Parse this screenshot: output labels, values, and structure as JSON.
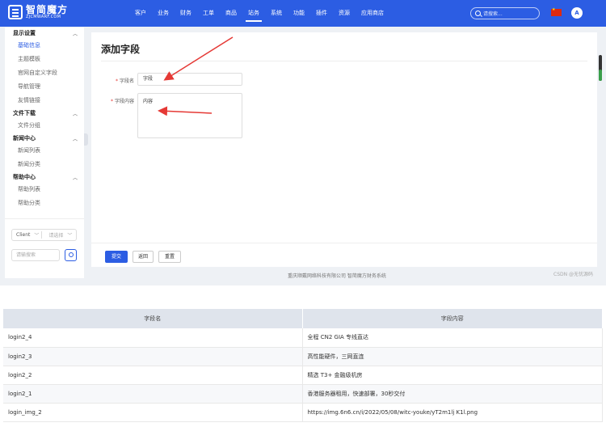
{
  "logo": {
    "cn": "智简魔方",
    "en": "ZJCMWARF.COM"
  },
  "nav": {
    "items": [
      "客户",
      "业务",
      "财务",
      "工单",
      "商品",
      "站务",
      "系统",
      "功能",
      "插件",
      "资源",
      "应用商店"
    ],
    "active_index": 5,
    "search_placeholder": "请搜索...",
    "avatar_letter": "A"
  },
  "sidebar": {
    "groups": [
      {
        "label": "显示设置",
        "items": [
          "基础信息",
          "主题模板",
          "官网自定义字段",
          "导航管理",
          "友情链接"
        ]
      },
      {
        "label": "文件下载",
        "items": [
          "文件分组"
        ]
      },
      {
        "label": "新闻中心",
        "items": [
          "新闻列表",
          "新闻分类"
        ]
      },
      {
        "label": "帮助中心",
        "items": [
          "帮助列表",
          "帮助分类"
        ]
      }
    ],
    "active_item": "基础信息",
    "client_select": "Client",
    "client_placeholder": "请选择",
    "search_placeholder": "请输搜索"
  },
  "form": {
    "title": "添加字段",
    "field_name_label": "字段名",
    "field_name_value": "字段",
    "field_content_label": "字段内容",
    "field_content_value": "内容",
    "submit_label": "提交",
    "back_label": "返回",
    "reset_label": "重置"
  },
  "footer": {
    "company": "重庆顺戴网络科技有限公司 智简魔方财务系统",
    "watermark": "CSDN @无忧源码"
  },
  "table": {
    "headers": [
      "字段名",
      "字段内容"
    ],
    "rows": [
      [
        "login2_4",
        "全程 CN2 GIA 专线直达"
      ],
      [
        "login2_3",
        "高性能硬件，三网直连"
      ],
      [
        "login2_2",
        "精选 T3+ 金融级机房"
      ],
      [
        "login2_1",
        "香港服务器租用，快速部署，30秒交付"
      ],
      [
        "login_img_2",
        "https://img.6n6.cn/i/2022/05/08/witc-youke/yT2m1lj K1l.png"
      ]
    ]
  },
  "colors": {
    "primary": "#2c5de3",
    "arrow": "#e53935"
  }
}
